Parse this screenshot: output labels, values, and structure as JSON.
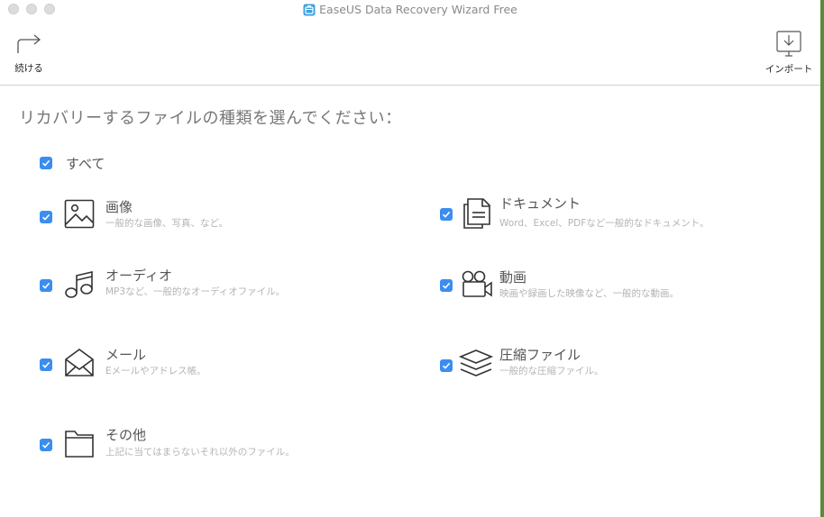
{
  "window": {
    "title": "EaseUS Data Recovery Wizard Free"
  },
  "toolbar": {
    "continue_label": "続ける",
    "import_label": "インポート"
  },
  "main": {
    "heading": "リカバリーするファイルの種類を選んでください：",
    "all": {
      "label": "すべて",
      "checked": true
    },
    "categories": [
      {
        "id": "images",
        "icon": "image-icon",
        "title": "画像",
        "desc": "一般的な画像、写真、など。",
        "checked": true
      },
      {
        "id": "documents",
        "icon": "document-icon",
        "title": "ドキュメント",
        "desc": "Word、Excel、PDFなど一般的なドキュメント。",
        "checked": true
      },
      {
        "id": "audio",
        "icon": "music-note-icon",
        "title": "オーディオ",
        "desc": "MP3など、一般的なオーディオファイル。",
        "checked": true
      },
      {
        "id": "video",
        "icon": "video-camera-icon",
        "title": "動画",
        "desc": "映画や録画した映像など、一般的な動画。",
        "checked": true
      },
      {
        "id": "email",
        "icon": "envelope-icon",
        "title": "メール",
        "desc": "Eメールやアドレス帳。",
        "checked": true
      },
      {
        "id": "archive",
        "icon": "layers-icon",
        "title": "圧縮ファイル",
        "desc": "一般的な圧縮ファイル。",
        "checked": true
      },
      {
        "id": "other",
        "icon": "folder-icon",
        "title": "その他",
        "desc": "上記に当てはまらないそれ以外のファイル。",
        "checked": true
      }
    ]
  },
  "colors": {
    "checkbox": "#3b8df0",
    "title_text": "#555555",
    "desc_text": "#b4b4b4"
  }
}
